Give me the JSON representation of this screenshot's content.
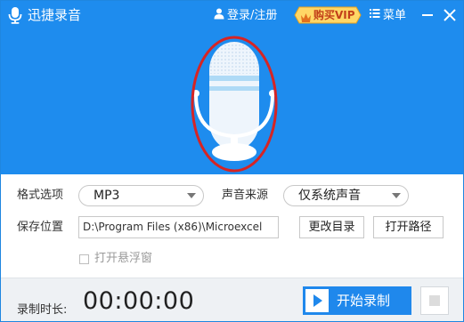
{
  "titlebar": {
    "app_title": "迅捷录音",
    "login_label": "登录/注册",
    "vip_label": "购买VIP",
    "menu_label": "菜单"
  },
  "settings": {
    "format_label": "格式选项",
    "format_value": "MP3",
    "source_label": "声音来源",
    "source_value": "仅系统声音",
    "save_label": "保存位置",
    "save_path": "D:\\Program Files (x86)\\Microexcel",
    "change_dir_label": "更改目录",
    "open_path_label": "打开路径",
    "float_window_label": "打开悬浮窗"
  },
  "bottom": {
    "duration_label": "录制时长:",
    "duration_value": "00:00:00",
    "start_label": "开始录制"
  },
  "colors": {
    "header_blue": "#1e8cee",
    "annotation_red": "#d62424",
    "vip_gold": "#f3b43a"
  },
  "icons": [
    "app-logo-mic-icon",
    "user-icon",
    "crown-icon",
    "menu-icon",
    "minimize-icon",
    "close-icon",
    "microphone-icon",
    "play-icon",
    "stop-icon",
    "dropdown-caret-icon"
  ]
}
